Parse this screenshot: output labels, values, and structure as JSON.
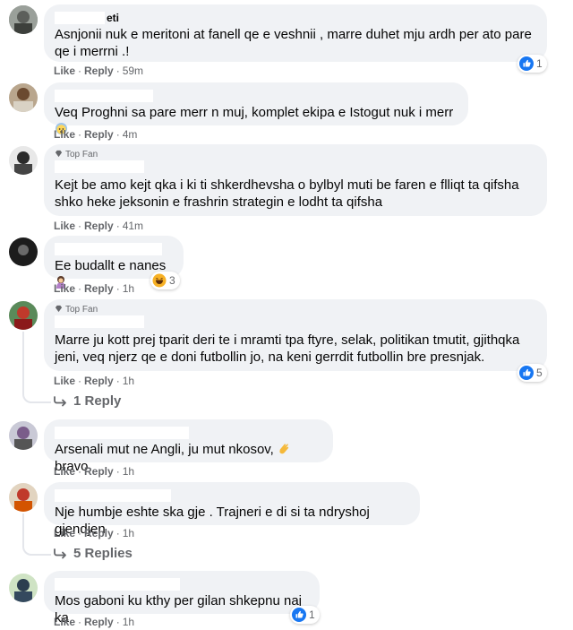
{
  "colors": {
    "bubble": "#f0f2f5",
    "like_blue": "#1877f2",
    "meta_gray": "#65676b"
  },
  "labels": {
    "like": "Like",
    "reply": "Reply",
    "dot": "·",
    "top_fan": "Top Fan"
  },
  "comments": [
    {
      "author": "eti",
      "text": "Asnjonii nuk e meritoni at fanell qe e veshnii , marre duhet mju ardh per ato pare qe i merrni .!",
      "time": "59m",
      "reaction": "like-icon",
      "reaction_count": "1"
    },
    {
      "author": "",
      "text": "Veq Proghni sa pare merr n muj, komplet ekipa e Istogut nuk i merr",
      "emoji": "cold-sweat-emoji",
      "time": "4m"
    },
    {
      "author": "",
      "badge": "Top Fan",
      "text": "Kejt be amo kejt qka i ki ti shkerdhevsha o bylbyl muti be faren e flliqt ta qifsha shko heke jeksonin e frashrin strategin e lodht ta qifsha",
      "time": "41m"
    },
    {
      "author": "",
      "text": "Ee budallt e nanes",
      "emoji": "person-facepalm-emoji",
      "time": "1h",
      "reaction": "haha-icon",
      "reaction_count": "3"
    },
    {
      "author": "",
      "badge": "Top Fan",
      "text": "Marre ju kott prej tparit deri te i mramti tpa ftyre, selak, politikan tmutit, gjithqka jeni, veq njerz qe e doni futbollin jo, na keni gerrdit futbollin bre presnjak.",
      "time": "1h",
      "reaction": "like-icon",
      "reaction_count": "5",
      "replies": "1 Reply"
    },
    {
      "author": "",
      "text": "Arsenali mut ne Angli, ju mut nkosov,",
      "text_after": "bravo",
      "emoji": "clapping-hands-emoji",
      "time": "1h"
    },
    {
      "author": "",
      "text": "Nje humbje eshte ska gje . Trajneri e di si ta ndryshoj gjendjen",
      "time": "1h",
      "replies": "5 Replies"
    },
    {
      "author": "",
      "text": "Mos gaboni ku kthy per gilan shkepnu naj ka",
      "time": "1h",
      "reaction": "like-icon",
      "reaction_count": "1"
    }
  ]
}
